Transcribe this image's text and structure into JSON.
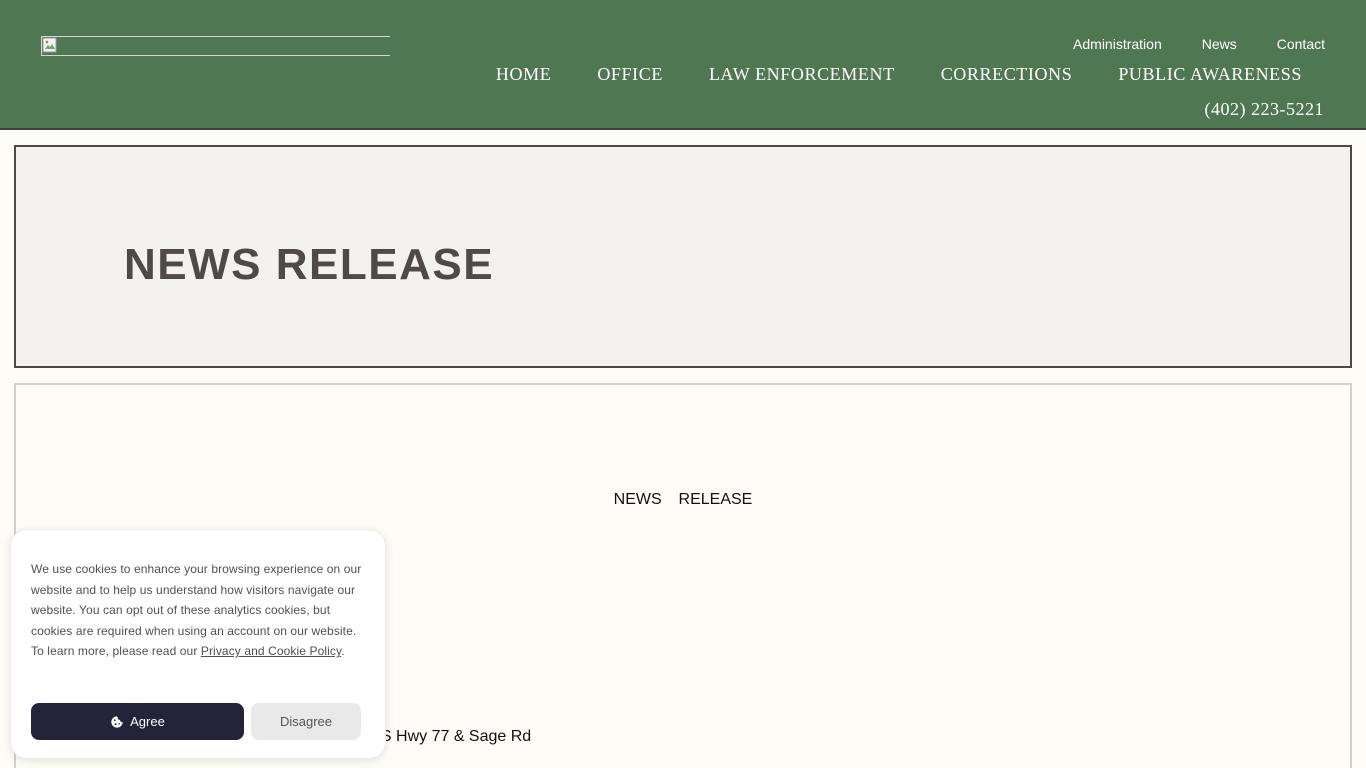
{
  "header": {
    "util_nav": [
      "Administration",
      "News",
      "Contact"
    ],
    "main_nav": [
      "HOME",
      "OFFICE",
      "LAW ENFORCEMENT",
      "CORRECTIONS",
      "PUBLIC AWARENESS"
    ],
    "phone": "(402) 223-5221",
    "colors": {
      "background": "#4f7852",
      "text": "#ffffff"
    }
  },
  "hero": {
    "title": "NEWS RELEASE"
  },
  "content": {
    "heading": "NEWS  RELEASE",
    "partial_line": "o US Hwy 77 & Sage Rd"
  },
  "cookie_banner": {
    "text_before_link": "We use cookies to enhance your browsing experience on our website and to help us understand how visitors navigate our website. You can opt out of these analytics cookies, but cookies are required when using an account on our website. To learn more, please read our ",
    "link_text": "Privacy and Cookie Policy",
    "text_after_link": ".",
    "agree_label": "Agree",
    "disagree_label": "Disagree",
    "agree_icon": "cookie-icon"
  }
}
